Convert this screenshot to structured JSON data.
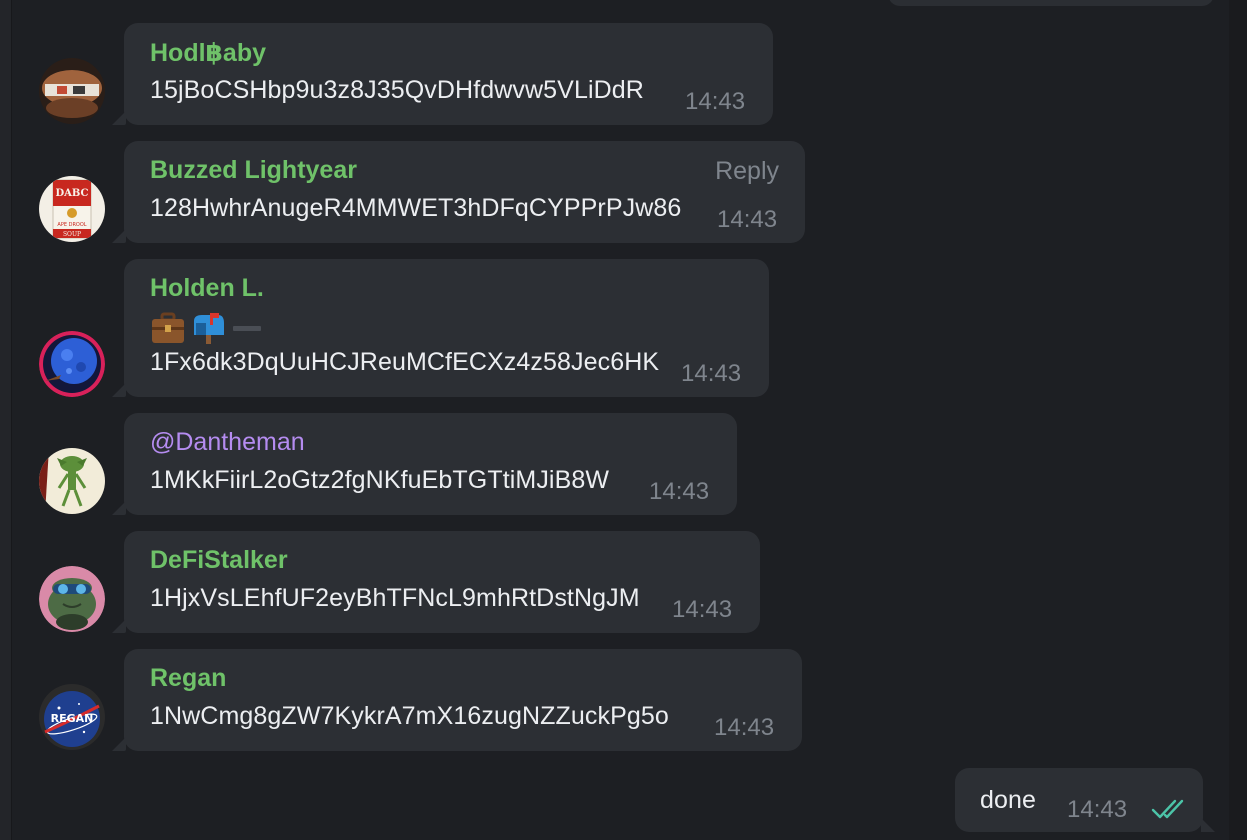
{
  "colors": {
    "name_green": "#6fc269",
    "name_purple": "#b58cf0",
    "bubble": "#2c2f34",
    "time": "#7f858d",
    "check": "#4cc4a8"
  },
  "messages": [
    {
      "sender": "Hodl฿aby",
      "text": "15jBoCSHbp9u3z8J35QvDHfdwvw5VLiDdR",
      "time": "14:43",
      "avatar": "hand-avatar-icon"
    },
    {
      "sender": "Buzzed Lightyear",
      "text": "128HwhrAnugeR4MMWET3hDFqCYPPrPJw86",
      "time": "14:43",
      "reply": "Reply",
      "avatar": "soup-can-avatar-icon"
    },
    {
      "sender": "Holden L.",
      "emojis": [
        "briefcase-icon",
        "mailbox-icon",
        "dash-icon"
      ],
      "text": "1Fx6dk3DqUuHCJReuMCfECXz4z58Jec6HK",
      "time": "14:43",
      "avatar": "moon-avatar-icon"
    },
    {
      "sender": "@Dantheman",
      "text": "1MKkFiirL2oGtz2fgNKfuEbTGTtiMJiB8W",
      "time": "14:43",
      "avatar": "gremlin-avatar-icon"
    },
    {
      "sender": "DeFiStalker",
      "text": "1HjxVsLEhfUF2eyBhTFNcL9mhRtDstNgJM",
      "time": "14:43",
      "avatar": "frog-avatar-icon"
    },
    {
      "sender": "Regan",
      "text": "1NwCmg8gZW7KykrA7mX16zugNZZuckPg5o",
      "time": "14:43",
      "avatar": "nasa-avatar-icon"
    }
  ],
  "own_message": {
    "text": "done",
    "time": "14:43",
    "status_icon": "double-check-icon"
  },
  "avatar_labels": {
    "regan": "REGAN",
    "soup_top": "DABC",
    "soup_bottom": "APE DROOL",
    "soup_foot": "SOUP"
  }
}
